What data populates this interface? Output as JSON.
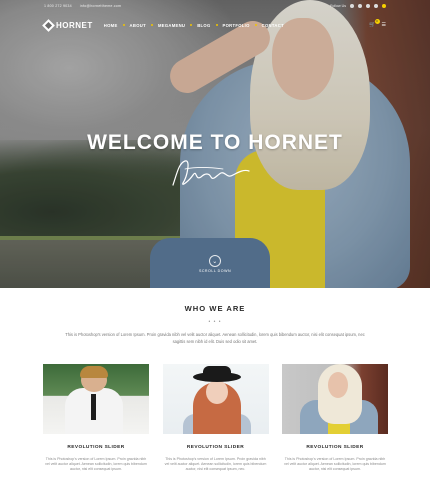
{
  "topbar": {
    "phone": "1 800 272 9034",
    "email": "info@hornettheme.com",
    "follow": "Follow Us"
  },
  "brand": {
    "name": "HORNET"
  },
  "nav": {
    "items": [
      {
        "label": "HOME"
      },
      {
        "label": "ABOUT"
      },
      {
        "label": "MEGAMENU"
      },
      {
        "label": "BLOG"
      },
      {
        "label": "PORTFOLIO"
      },
      {
        "label": "CONTACT"
      }
    ],
    "cart_count": "0"
  },
  "hero": {
    "title": "WELCOME TO HORNET",
    "scroll_label": "SCROLL DOWN"
  },
  "who": {
    "title": "WHO WE ARE",
    "dots": "• • •",
    "intro": "This is Photoshop's version of Lorem Ipsum. Proin gravida nibh vel velit auctor aliquet. Aenean sollicitudin, lorem quis bibendum auctor, nisi elit consequat ipsum, nec sagittis sem nibh id elit. Duis sed odio sit amet."
  },
  "cards": [
    {
      "title": "REVOLUTION SLIDER",
      "text": "This is Photoshop's version of Lorem Ipsum. Proin gravida nibh vel velit auctor aliquet. Aenean sollicitudin, lorem quis bibendum auctor, nisi elit consequat ipsum."
    },
    {
      "title": "REVOLUTION SLIDER",
      "text": "This is Photoshop's version of Lorem Ipsum. Proin gravida nibh vel velit auctor aliquet. Aenean sollicitudin, lorem quis bibendum auctor, nisi elit consequat ipsum, nec."
    },
    {
      "title": "REVOLUTION SLIDER",
      "text": "This is Photoshop's version of Lorem Ipsum. Proin gravida nibh vel velit auctor aliquet. Aenean sollicitudin, lorem quis bibendum auctor, nisi elit consequat ipsum."
    }
  ],
  "colors": {
    "accent": "#f6d000"
  }
}
